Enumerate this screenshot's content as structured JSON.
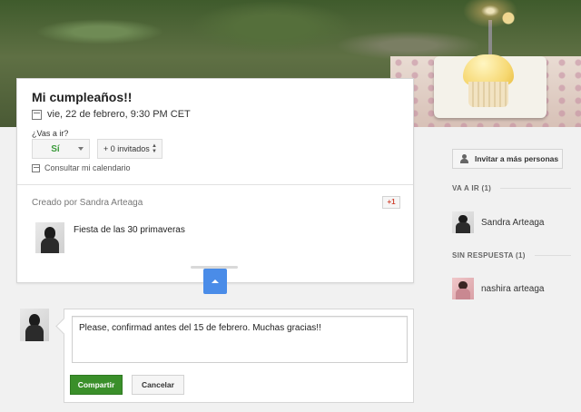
{
  "event": {
    "title": "Mi cumpleaños!!",
    "date": "vie, 22 de febrero, 9:30 PM CET",
    "question": "¿Vas a ir?",
    "rsvp_value": "Sí",
    "guests_value": "+ 0 invitados",
    "consult_calendar": "Consultar mi calendario",
    "created_by": "Creado por Sandra Arteaga",
    "plus_one": "+1",
    "description": "Fiesta de las 30 primaveras"
  },
  "comment": {
    "text": "Please, confirmad antes del 15 de febrero. Muchas gracias!!",
    "share_label": "Compartir",
    "cancel_label": "Cancelar"
  },
  "sidebar": {
    "invite_label": "Invitar a más personas",
    "going_header": "VA A IR (1)",
    "no_response_header": "SIN RESPUESTA (1)",
    "going": [
      {
        "name": "Sandra Arteaga"
      }
    ],
    "no_response": [
      {
        "name": "nashira arteaga"
      }
    ]
  },
  "colors": {
    "accent_blue": "#4a8ce8",
    "share_green": "#3a8f2a",
    "rsvp_green": "#3b9b3b",
    "plus_one_red": "#d14836"
  },
  "icons": [
    "calendar-icon",
    "chevron-down-icon",
    "stepper-icon",
    "plus-one-icon",
    "collapse-arrow-icon",
    "add-person-icon"
  ]
}
